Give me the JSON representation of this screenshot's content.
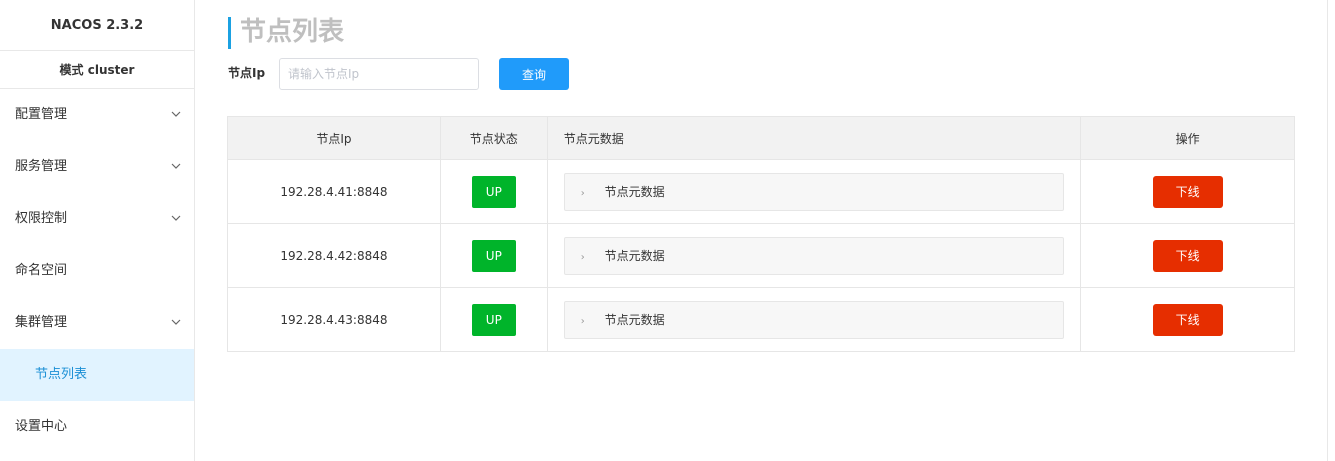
{
  "brand": "NACOS 2.3.2",
  "mode_label": "模式 cluster",
  "nav": {
    "items": [
      {
        "label": "配置管理"
      },
      {
        "label": "服务管理"
      },
      {
        "label": "权限控制"
      },
      {
        "label": "命名空间"
      },
      {
        "label": "集群管理"
      }
    ],
    "sub_active": "节点列表",
    "last": "设置中心"
  },
  "page_title": "节点列表",
  "search": {
    "label": "节点Ip",
    "placeholder": "请输入节点Ip",
    "value": "",
    "button": "查询"
  },
  "table": {
    "headers": [
      "节点Ip",
      "节点状态",
      "节点元数据",
      "操作"
    ],
    "rows": [
      {
        "ip": "192.28.4.41:8848",
        "state": "UP",
        "meta": "节点元数据",
        "action": "下线"
      },
      {
        "ip": "192.28.4.42:8848",
        "state": "UP",
        "meta": "节点元数据",
        "action": "下线"
      },
      {
        "ip": "192.28.4.43:8848",
        "state": "UP",
        "meta": "节点元数据",
        "action": "下线"
      }
    ]
  },
  "colors": {
    "accent": "#209bfa",
    "up": "#00b42a",
    "offline": "#e62e00",
    "active_nav_bg": "#e1f3ff",
    "active_nav_text": "#1a8fd5",
    "title_bar": "#1ba1e2"
  },
  "icons": {
    "expand": "chevron-down-icon",
    "meta_toggle": "caret-right-icon"
  }
}
